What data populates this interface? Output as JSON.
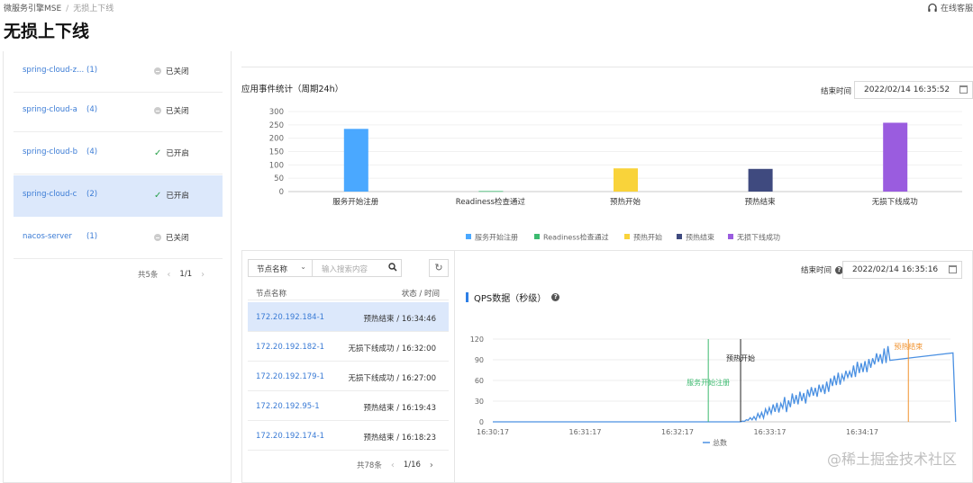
{
  "breadcrumb": {
    "root": "微服务引擎MSE",
    "sep": "/",
    "current": "无损上下线"
  },
  "helpdesk": "在线客服",
  "page_title": "无损上下线",
  "apps": [
    {
      "name": "spring-cloud-z...",
      "count": "(1)",
      "status": "已关闭",
      "enabled": false,
      "selected": false
    },
    {
      "name": "spring-cloud-a",
      "count": "(4)",
      "status": "已关闭",
      "enabled": false,
      "selected": false
    },
    {
      "name": "spring-cloud-b",
      "count": "(4)",
      "status": "已开启",
      "enabled": true,
      "selected": false
    },
    {
      "name": "spring-cloud-c",
      "count": "(2)",
      "status": "已开启",
      "enabled": true,
      "selected": true
    },
    {
      "name": "nacos-server",
      "count": "(1)",
      "status": "已关闭",
      "enabled": false,
      "selected": false
    }
  ],
  "apps_pager": {
    "total": "共5条",
    "page": "1/1"
  },
  "stats": {
    "title": "应用事件统计（周期24h）",
    "end_label": "结束时间",
    "end_value": "2022/02/14 16:35:52"
  },
  "chart_data": [
    {
      "type": "bar",
      "title": "应用事件统计（周期24h）",
      "categories": [
        "服务开始注册",
        "Readiness检查通过",
        "预热开始",
        "预热结束",
        "无损下线成功"
      ],
      "values": [
        235,
        2,
        87,
        85,
        258
      ],
      "colors": [
        "#4aa8ff",
        "#3cba6f",
        "#f9d33a",
        "#3f4a7f",
        "#9a5cdf"
      ],
      "yticks": [
        "0",
        "50",
        "100",
        "150",
        "200",
        "250",
        "300"
      ],
      "ylim": [
        0,
        300
      ],
      "legend": [
        "服务开始注册",
        "Readiness检查通过",
        "预热开始",
        "预热结束",
        "无损下线成功"
      ],
      "legend_position": "bottom"
    },
    {
      "type": "line",
      "title": "QPS数据（秒级）",
      "xticks": [
        "16:30:17",
        "16:31:17",
        "16:32:17",
        "16:33:17",
        "16:34:17"
      ],
      "yticks": [
        "0",
        "30",
        "60",
        "90",
        "120"
      ],
      "ylim": [
        0,
        120
      ],
      "series": [
        {
          "name": "总数",
          "color": "#4a90e2"
        }
      ],
      "shape": {
        "flat_until": "16:32:58",
        "ramp_start": 0,
        "ramp_end_time": "16:34:35",
        "ramp_end_value": 100,
        "plateau_value": 100,
        "drop_time": "16:35:16"
      },
      "markers": [
        {
          "label": "服务开始注册",
          "time": "16:32:37",
          "color": "#3cba6f"
        },
        {
          "label": "预热开始",
          "time": "16:32:58",
          "color": "#222222"
        },
        {
          "label": "预热结束",
          "time": "16:34:47",
          "color": "#f0922e"
        }
      ],
      "legend_position": "bottom"
    }
  ],
  "nodes": {
    "select_label": "节点名称",
    "search_placeholder": "输入搜索内容",
    "col_name": "节点名称",
    "col_status": "状态 / 时间",
    "rows": [
      {
        "ip": "172.20.192.184-1",
        "status": "预热结束 / 16:34:46",
        "selected": true
      },
      {
        "ip": "172.20.192.182-1",
        "status": "无损下线成功 / 16:32:00",
        "selected": false
      },
      {
        "ip": "172.20.192.179-1",
        "status": "无损下线成功 / 16:27:00",
        "selected": false
      },
      {
        "ip": "172.20.192.95-1",
        "status": "预热结束 / 16:19:43",
        "selected": false
      },
      {
        "ip": "172.20.192.174-1",
        "status": "预热结束 / 16:18:23",
        "selected": false
      }
    ],
    "pager": {
      "total": "共78条",
      "page": "1/16"
    }
  },
  "qps": {
    "title": "QPS数据（秒级）",
    "end_label": "结束时间",
    "end_value": "2022/02/14 16:35:16"
  },
  "watermark": "@稀土掘金技术社区"
}
